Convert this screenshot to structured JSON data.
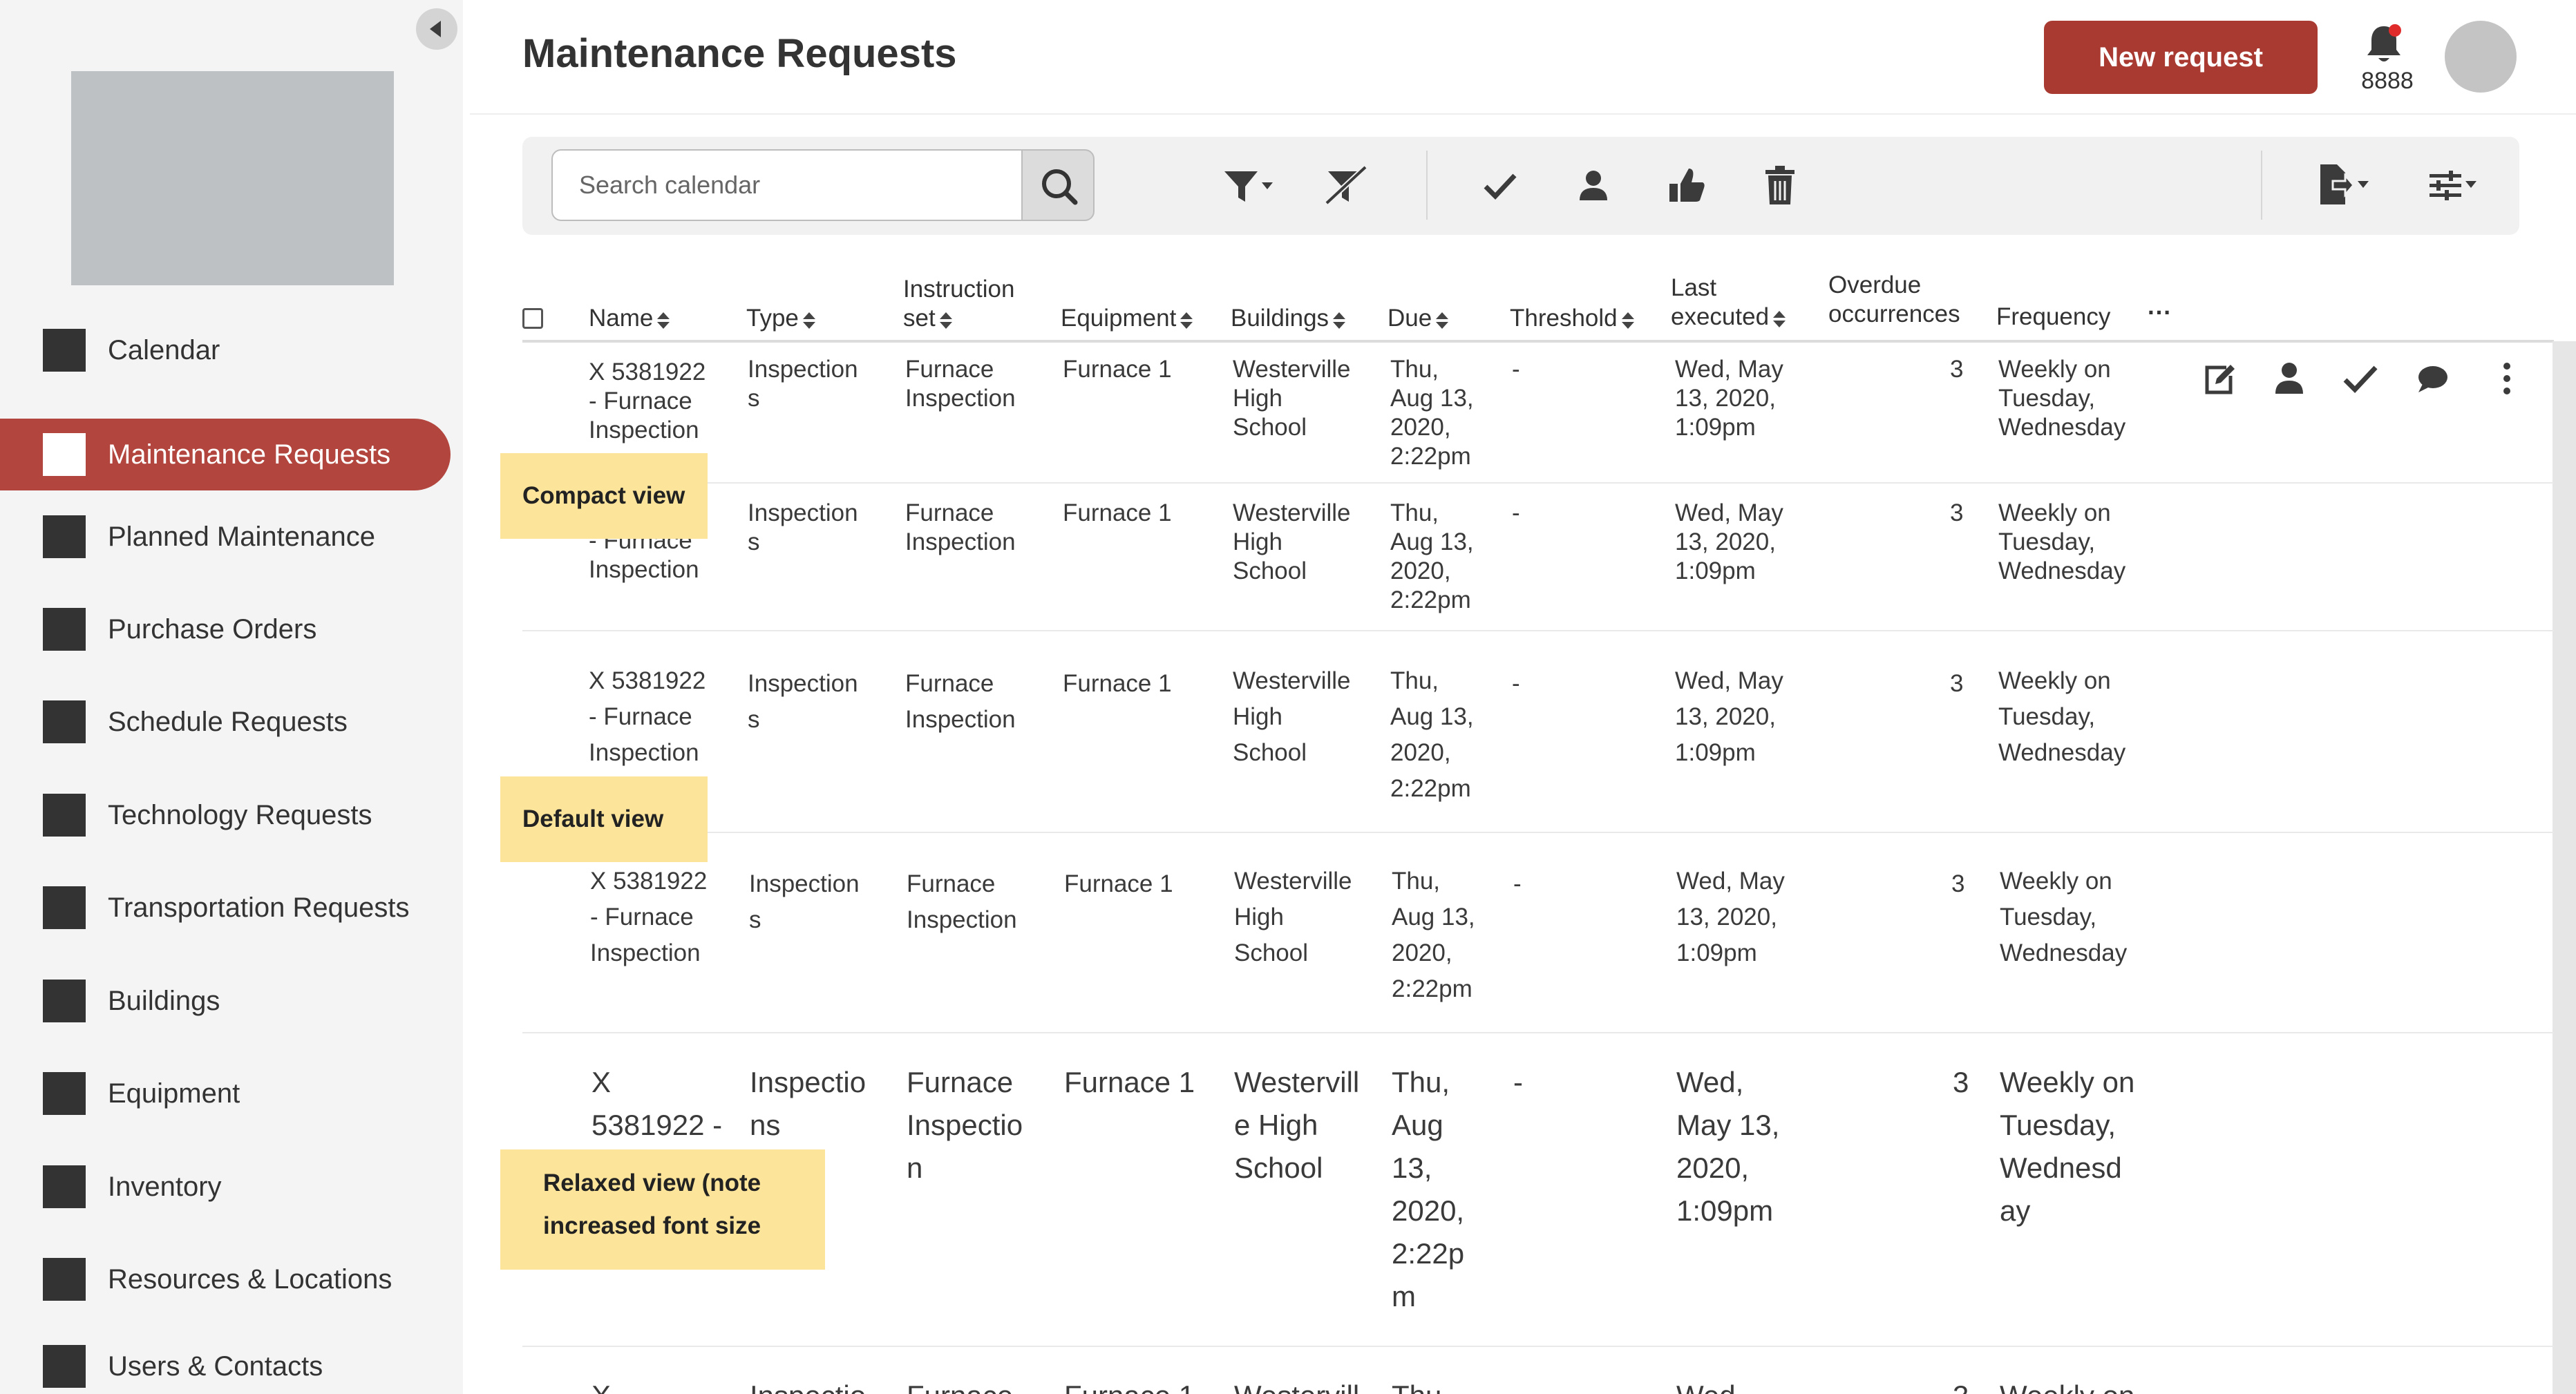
{
  "sidebar": {
    "items": [
      {
        "label": "Calendar",
        "active": false
      },
      {
        "label": "Maintenance Requests",
        "active": true
      },
      {
        "label": "Planned Maintenance",
        "active": false
      },
      {
        "label": "Purchase Orders",
        "active": false
      },
      {
        "label": "Schedule Requests",
        "active": false
      },
      {
        "label": "Technology Requests",
        "active": false
      },
      {
        "label": "Transportation Requests",
        "active": false
      },
      {
        "label": "Buildings",
        "active": false
      },
      {
        "label": "Equipment",
        "active": false
      },
      {
        "label": "Inventory",
        "active": false
      },
      {
        "label": "Resources & Locations",
        "active": false
      },
      {
        "label": "Users & Contacts",
        "active": false
      }
    ]
  },
  "header": {
    "title": "Maintenance Requests",
    "new_request_label": "New request",
    "notification_count": "8888"
  },
  "toolbar": {
    "search_placeholder": "Search calendar"
  },
  "table": {
    "columns": {
      "name": "Name",
      "type": "Type",
      "instruction_set": "Instruction\nset",
      "equipment": "Equipment",
      "buildings": "Buildings",
      "due": "Due",
      "threshold": "Threshold",
      "last_executed": "Last\nexecuted",
      "overdue": "Overdue\noccurrences",
      "frequency": "Frequency",
      "more": "···"
    },
    "row": {
      "name": "X 5381922 - Furnace Inspection",
      "type": "Inspections",
      "instruction_set": "Furnace Inspection",
      "equipment": "Furnace 1",
      "building": "Westerville High School",
      "due": "Thu, Aug 13, 2020, 2:22pm",
      "threshold": "-",
      "last_executed": "Wed, May 13, 2020, 1:09pm",
      "overdue": "3",
      "frequency": "Weekly on Tuesday, Wednesday"
    },
    "views": {
      "compact": {
        "name": "X 5381922\n- Furnace\nInspection",
        "name_partial": "- Furnace\nInspection",
        "type": "Inspection\ns",
        "instruction_set": "Furnace\nInspection",
        "equipment": "Furnace 1",
        "building": "Westerville\nHigh\nSchool",
        "due": "Thu,\nAug 13,\n2020,\n2:22pm",
        "threshold": "-",
        "last_executed": "Wed, May\n13, 2020,\n1:09pm",
        "overdue": "3",
        "frequency": "Weekly on\nTuesday,\nWednesday"
      },
      "relaxed": {
        "name": "X\n5381922 -",
        "type": "Inspectio\nns",
        "instruction_set": "Furnace\nInspectio\nn",
        "equipment": "Furnace 1",
        "building": "Westervill\ne High\nSchool",
        "due": "Thu,\nAug\n13,\n2020,\n2:22p\nm",
        "threshold": "-",
        "last_executed": "Wed,\nMay 13,\n2020,\n1:09pm",
        "overdue": "3",
        "frequency": "Weekly on\nTuesday,\nWednesd\nay"
      },
      "partial_row": {
        "name": "X",
        "type": "Inspectio",
        "instruction_set": "Furnace",
        "equipment": "Furnace 1",
        "building": "Westervill",
        "due": "Thu,",
        "last_executed": "Wed,",
        "overdue": "3",
        "frequency": "Weekly on"
      }
    }
  },
  "callouts": {
    "compact": "Compact view",
    "default": "Default view",
    "relaxed": "Relaxed view (note\nincreased font size"
  },
  "icons": {
    "toolbar": [
      "search-icon",
      "filter-dropdown-icon",
      "clear-filter-icon",
      "check-icon",
      "assign-user-icon",
      "thumbs-up-icon",
      "trash-icon",
      "export-dropdown-icon",
      "column-settings-dropdown-icon"
    ],
    "row_actions": [
      "edit-icon",
      "assign-user-icon",
      "check-icon",
      "comment-icon",
      "more-vertical-icon"
    ]
  },
  "colors": {
    "accent": "#b2463e",
    "button": "#a83a31",
    "callout": "#fce49a",
    "notification_dot": "#e02b2b"
  }
}
